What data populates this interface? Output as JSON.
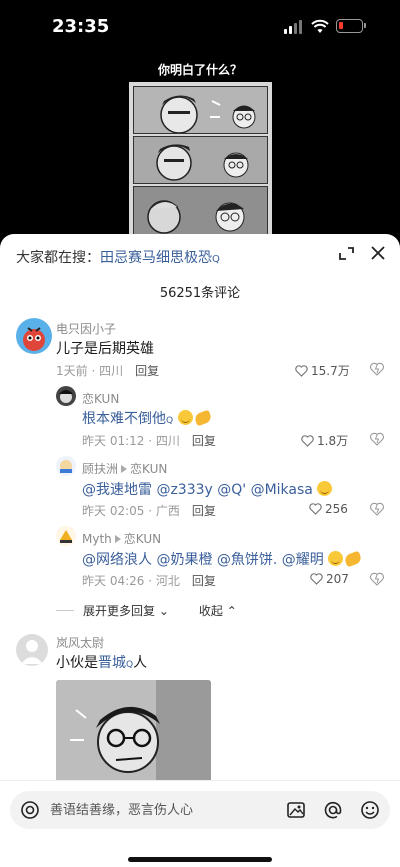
{
  "status": {
    "time": "23:35"
  },
  "video": {
    "caption": "你明白了什么？"
  },
  "sheet": {
    "search_prefix": "大家都在搜：",
    "search_term": "田忌赛马细思极恐",
    "comment_count": "56251条评论"
  },
  "comments": [
    {
      "user": "电只因小子",
      "text": "儿子是后期英雄",
      "time": "1天前 · 四川",
      "reply": "回复",
      "likes": "15.7万",
      "replies": [
        {
          "user": "恋KUN",
          "text": "根本难不倒他",
          "time": "昨天 01:12 · 四川",
          "reply": "回复",
          "likes": "1.8万"
        },
        {
          "user": "顾扶洲",
          "reply_to": "恋KUN",
          "text": "@我速地雷 @z333y @Q' @Mikasa",
          "time": "昨天 02:05 · 广西",
          "reply": "回复",
          "likes": "256"
        },
        {
          "user": "Myth",
          "reply_to": "恋KUN",
          "text": "@网络浪人 @奶果橙 @魚饼饼. @耀明",
          "time": "昨天 04:26 · 河北",
          "reply": "回复",
          "likes": "207"
        }
      ],
      "expand_label": "展开更多回复",
      "collapse_label": "收起"
    },
    {
      "user": "岚风太尉",
      "text_prefix": "小伙是",
      "text_link": "晋城",
      "text_suffix": "人"
    }
  ],
  "input": {
    "placeholder": "善语结善缘，恶言伤人心"
  },
  "colors": {
    "link": "#3a5f9b",
    "battery_low": "#ff3b30"
  },
  "icons": [
    "signal-icon",
    "wifi-icon",
    "battery-icon",
    "expand-icon",
    "close-icon",
    "heart-icon",
    "dislike-icon",
    "camera-icon",
    "image-icon",
    "at-icon",
    "emoji-icon"
  ]
}
